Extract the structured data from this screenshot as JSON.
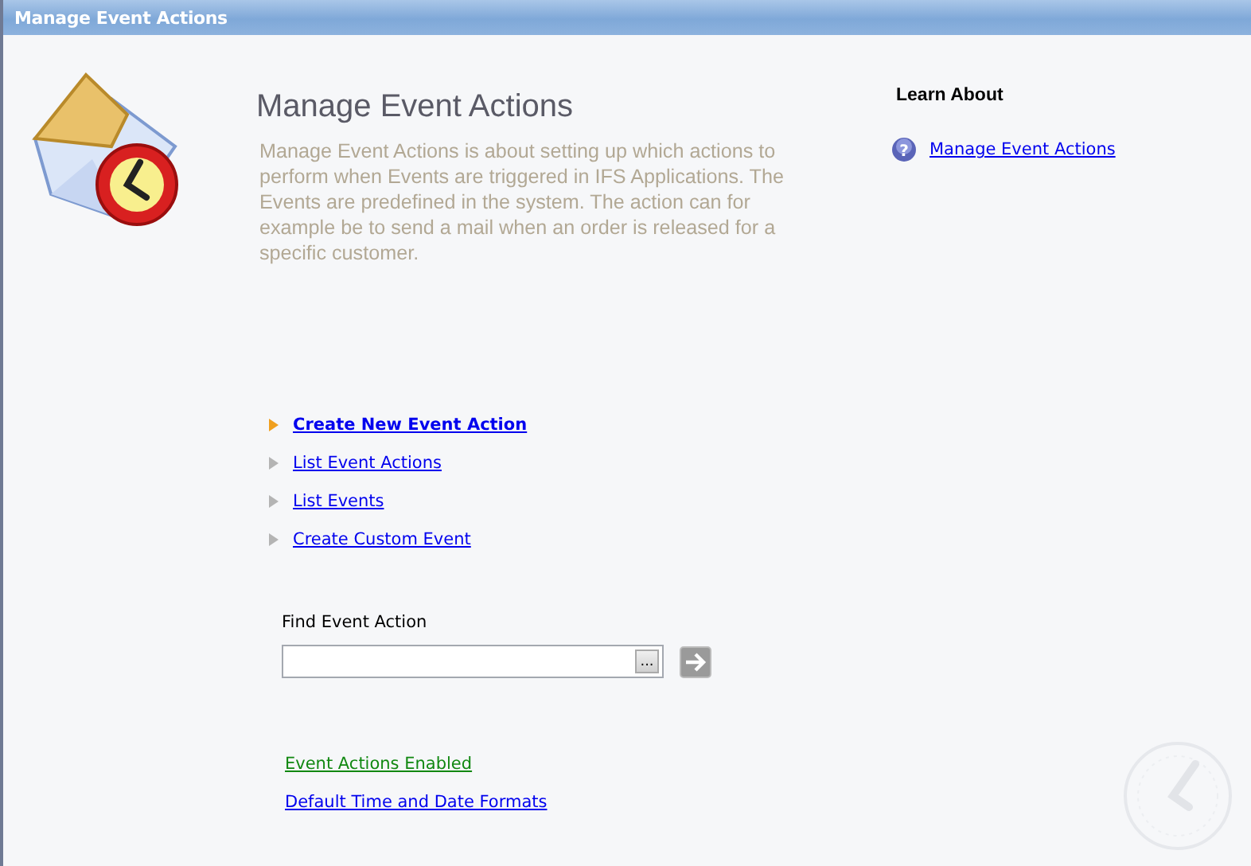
{
  "window": {
    "title": "Manage Event Actions"
  },
  "header": {
    "title": "Manage Event Actions",
    "description": "Manage Event Actions is about setting up which actions to perform when Events are triggered in IFS Applications. The Events are predefined in the system. The action can for example be to send a mail when an order is released for a specific customer."
  },
  "learn_about": {
    "title": "Learn About",
    "links": [
      {
        "icon": "?",
        "label": "Manage Event Actions"
      }
    ]
  },
  "actions": [
    {
      "label": "Create New Event Action",
      "selected": true
    },
    {
      "label": "List Event Actions",
      "selected": false
    },
    {
      "label": "List Events",
      "selected": false
    },
    {
      "label": "Create Custom Event",
      "selected": false
    }
  ],
  "find": {
    "label": "Find Event Action",
    "browse_button": "..."
  },
  "settings_links": [
    {
      "label": "Event Actions Enabled",
      "kind": "status"
    },
    {
      "label": "Default Time and Date Formats",
      "kind": "link"
    }
  ]
}
